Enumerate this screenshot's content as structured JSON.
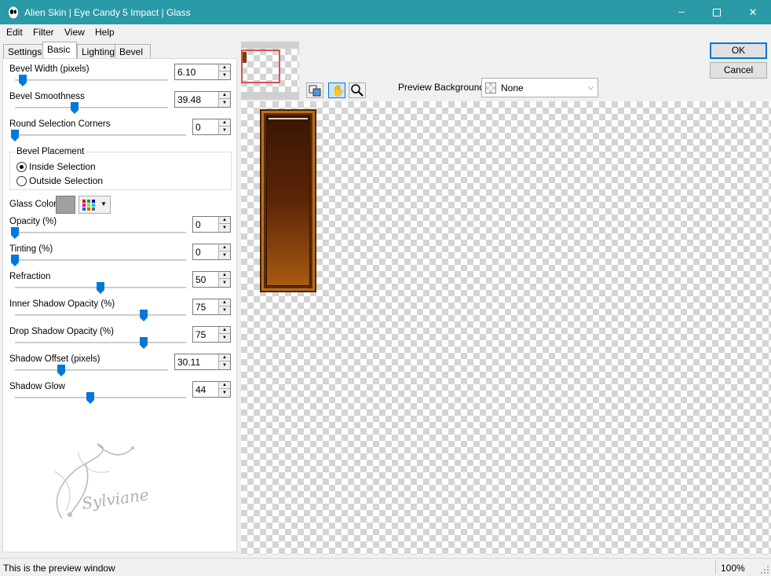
{
  "window": {
    "title": "Alien Skin | Eye Candy 5 Impact | Glass",
    "minimize_glyph": "─",
    "close_glyph": "✕"
  },
  "menu": [
    {
      "label": "Edit"
    },
    {
      "label": "Filter"
    },
    {
      "label": "View"
    },
    {
      "label": "Help"
    }
  ],
  "tabs": [
    {
      "label": "Settings"
    },
    {
      "label": "Basic"
    },
    {
      "label": "Lighting"
    },
    {
      "label": "Bevel Profile"
    }
  ],
  "active_tab": "Basic",
  "controls": {
    "bevel_width": {
      "label": "Bevel Width (pixels)",
      "value": "6.10",
      "slider_fraction": 0.05
    },
    "bevel_smoothness": {
      "label": "Bevel Smoothness",
      "value": "39.48",
      "slider_fraction": 0.39
    },
    "round_corners": {
      "label": "Round Selection Corners",
      "value": "0",
      "slider_fraction": 0.0
    },
    "opacity": {
      "label": "Opacity (%)",
      "value": "0",
      "slider_fraction": 0.0
    },
    "tinting": {
      "label": "Tinting (%)",
      "value": "0",
      "slider_fraction": 0.0
    },
    "refraction": {
      "label": "Refraction",
      "value": "50",
      "slider_fraction": 0.5
    },
    "inner_shadow_opacity": {
      "label": "Inner Shadow Opacity (%)",
      "value": "75",
      "slider_fraction": 0.75
    },
    "drop_shadow_opacity": {
      "label": "Drop Shadow Opacity (%)",
      "value": "75",
      "slider_fraction": 0.75
    },
    "shadow_offset": {
      "label": "Shadow Offset (pixels)",
      "value": "30.11",
      "slider_fraction": 0.3
    },
    "shadow_glow": {
      "label": "Shadow Glow",
      "value": "44",
      "slider_fraction": 0.44
    }
  },
  "bevel_placement": {
    "legend": "Bevel Placement",
    "options": [
      {
        "label": "Inside Selection",
        "selected": true
      },
      {
        "label": "Outside Selection",
        "selected": false
      }
    ]
  },
  "glass_color": {
    "label": "Glass Color",
    "swatch": "#a0a0a0"
  },
  "buttons": {
    "ok": "OK",
    "cancel": "Cancel"
  },
  "preview_background": {
    "label": "Preview Background:",
    "value": "None"
  },
  "status": {
    "text": "This is the preview window",
    "zoom": "100%"
  },
  "watermark": {
    "text": "Sylviane"
  },
  "accent_color": "#0078d7",
  "titlebar_color": "#2a9aa6"
}
